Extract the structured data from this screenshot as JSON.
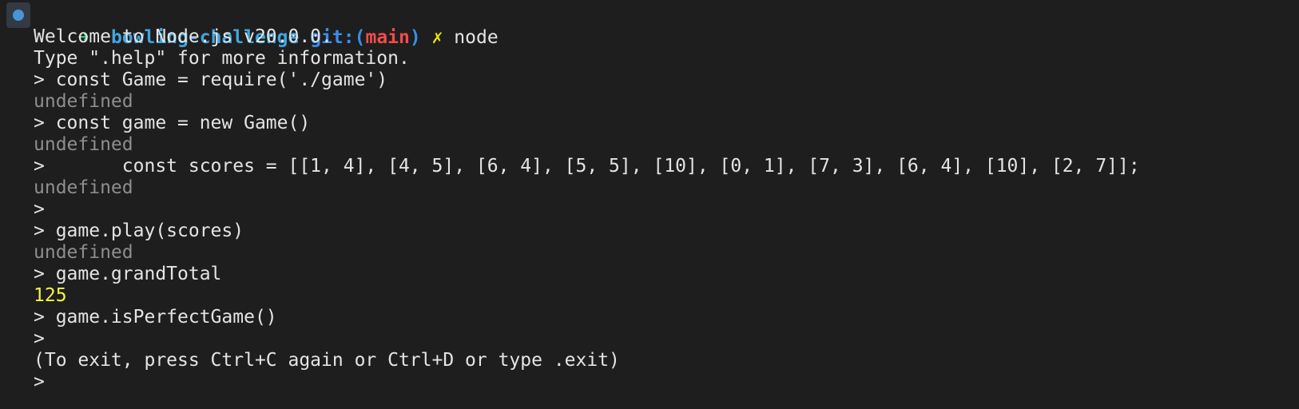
{
  "terminal": {
    "prompt": {
      "arrow": "➜",
      "directory": "bowling-challenge",
      "git_label": "git:(",
      "branch": "main",
      "git_close": ")",
      "dirty_marker": "✗",
      "command": "node"
    },
    "lines": [
      {
        "text": "Welcome to Node.js v20.0.0.",
        "style": "normal"
      },
      {
        "text": "Type \".help\" for more information.",
        "style": "normal"
      },
      {
        "text": "> const Game = require('./game')",
        "style": "normal"
      },
      {
        "text": "undefined",
        "style": "dim"
      },
      {
        "text": "> const game = new Game()",
        "style": "normal"
      },
      {
        "text": "undefined",
        "style": "dim"
      },
      {
        "text": ">       const scores = [[1, 4], [4, 5], [6, 4], [5, 5], [10], [0, 1], [7, 3], [6, 4], [10], [2, 7]];",
        "style": "normal"
      },
      {
        "text": "undefined",
        "style": "dim"
      },
      {
        "text": ">",
        "style": "normal"
      },
      {
        "text": "> game.play(scores)",
        "style": "normal"
      },
      {
        "text": "undefined",
        "style": "dim"
      },
      {
        "text": "> game.grandTotal",
        "style": "normal"
      },
      {
        "text": "125",
        "style": "yellow"
      },
      {
        "text": "> game.isPerfectGame()",
        "style": "normal"
      },
      {
        "text": ">",
        "style": "normal"
      },
      {
        "text": "(To exit, press Ctrl+C again or Ctrl+D or type .exit)",
        "style": "normal"
      },
      {
        "text": ">",
        "style": "normal"
      }
    ]
  },
  "colors": {
    "background": "#1e1e1e",
    "foreground": "#e4e4e4",
    "dim": "#8e8e8e",
    "number": "#f5f543",
    "arrow": "#2bd47a",
    "directory": "#3fa6e0",
    "branch": "#f14c4c"
  },
  "icons": {
    "command_marker": "circle-marker-icon"
  }
}
